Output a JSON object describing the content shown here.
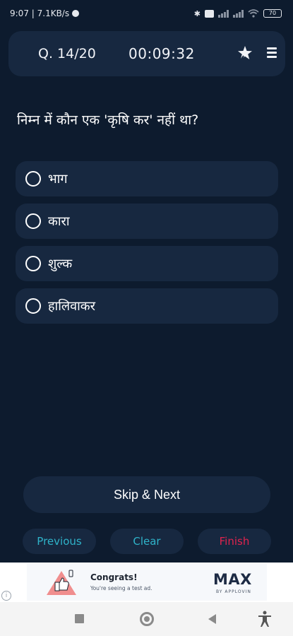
{
  "status_bar": {
    "time_speed": "9:07 | 7.1KB/s",
    "battery": "70"
  },
  "header": {
    "question_counter": "Q. 14/20",
    "timer": "00:09:32",
    "icons": [
      "star-pin-icon",
      "menu-icon"
    ]
  },
  "question": {
    "text": "निम्न में कौन एक 'कृषि कर' नहीं था?"
  },
  "options": [
    {
      "label": "भाग"
    },
    {
      "label": "कारा"
    },
    {
      "label": "शुल्क"
    },
    {
      "label": "हालिवाकर"
    }
  ],
  "actions": {
    "skip_next": "Skip & Next",
    "previous": "Previous",
    "clear": "Clear",
    "finish": "Finish"
  },
  "colors": {
    "background": "#0d1b2e",
    "card": "#172840",
    "accent_cyan": "#2fb3c9",
    "accent_red": "#e0234e"
  },
  "ad": {
    "title": "Congrats!",
    "subtitle": "You're seeing a test ad.",
    "brand": "MAX",
    "brand_sub": "BY APPLOVIN",
    "info": "i"
  }
}
